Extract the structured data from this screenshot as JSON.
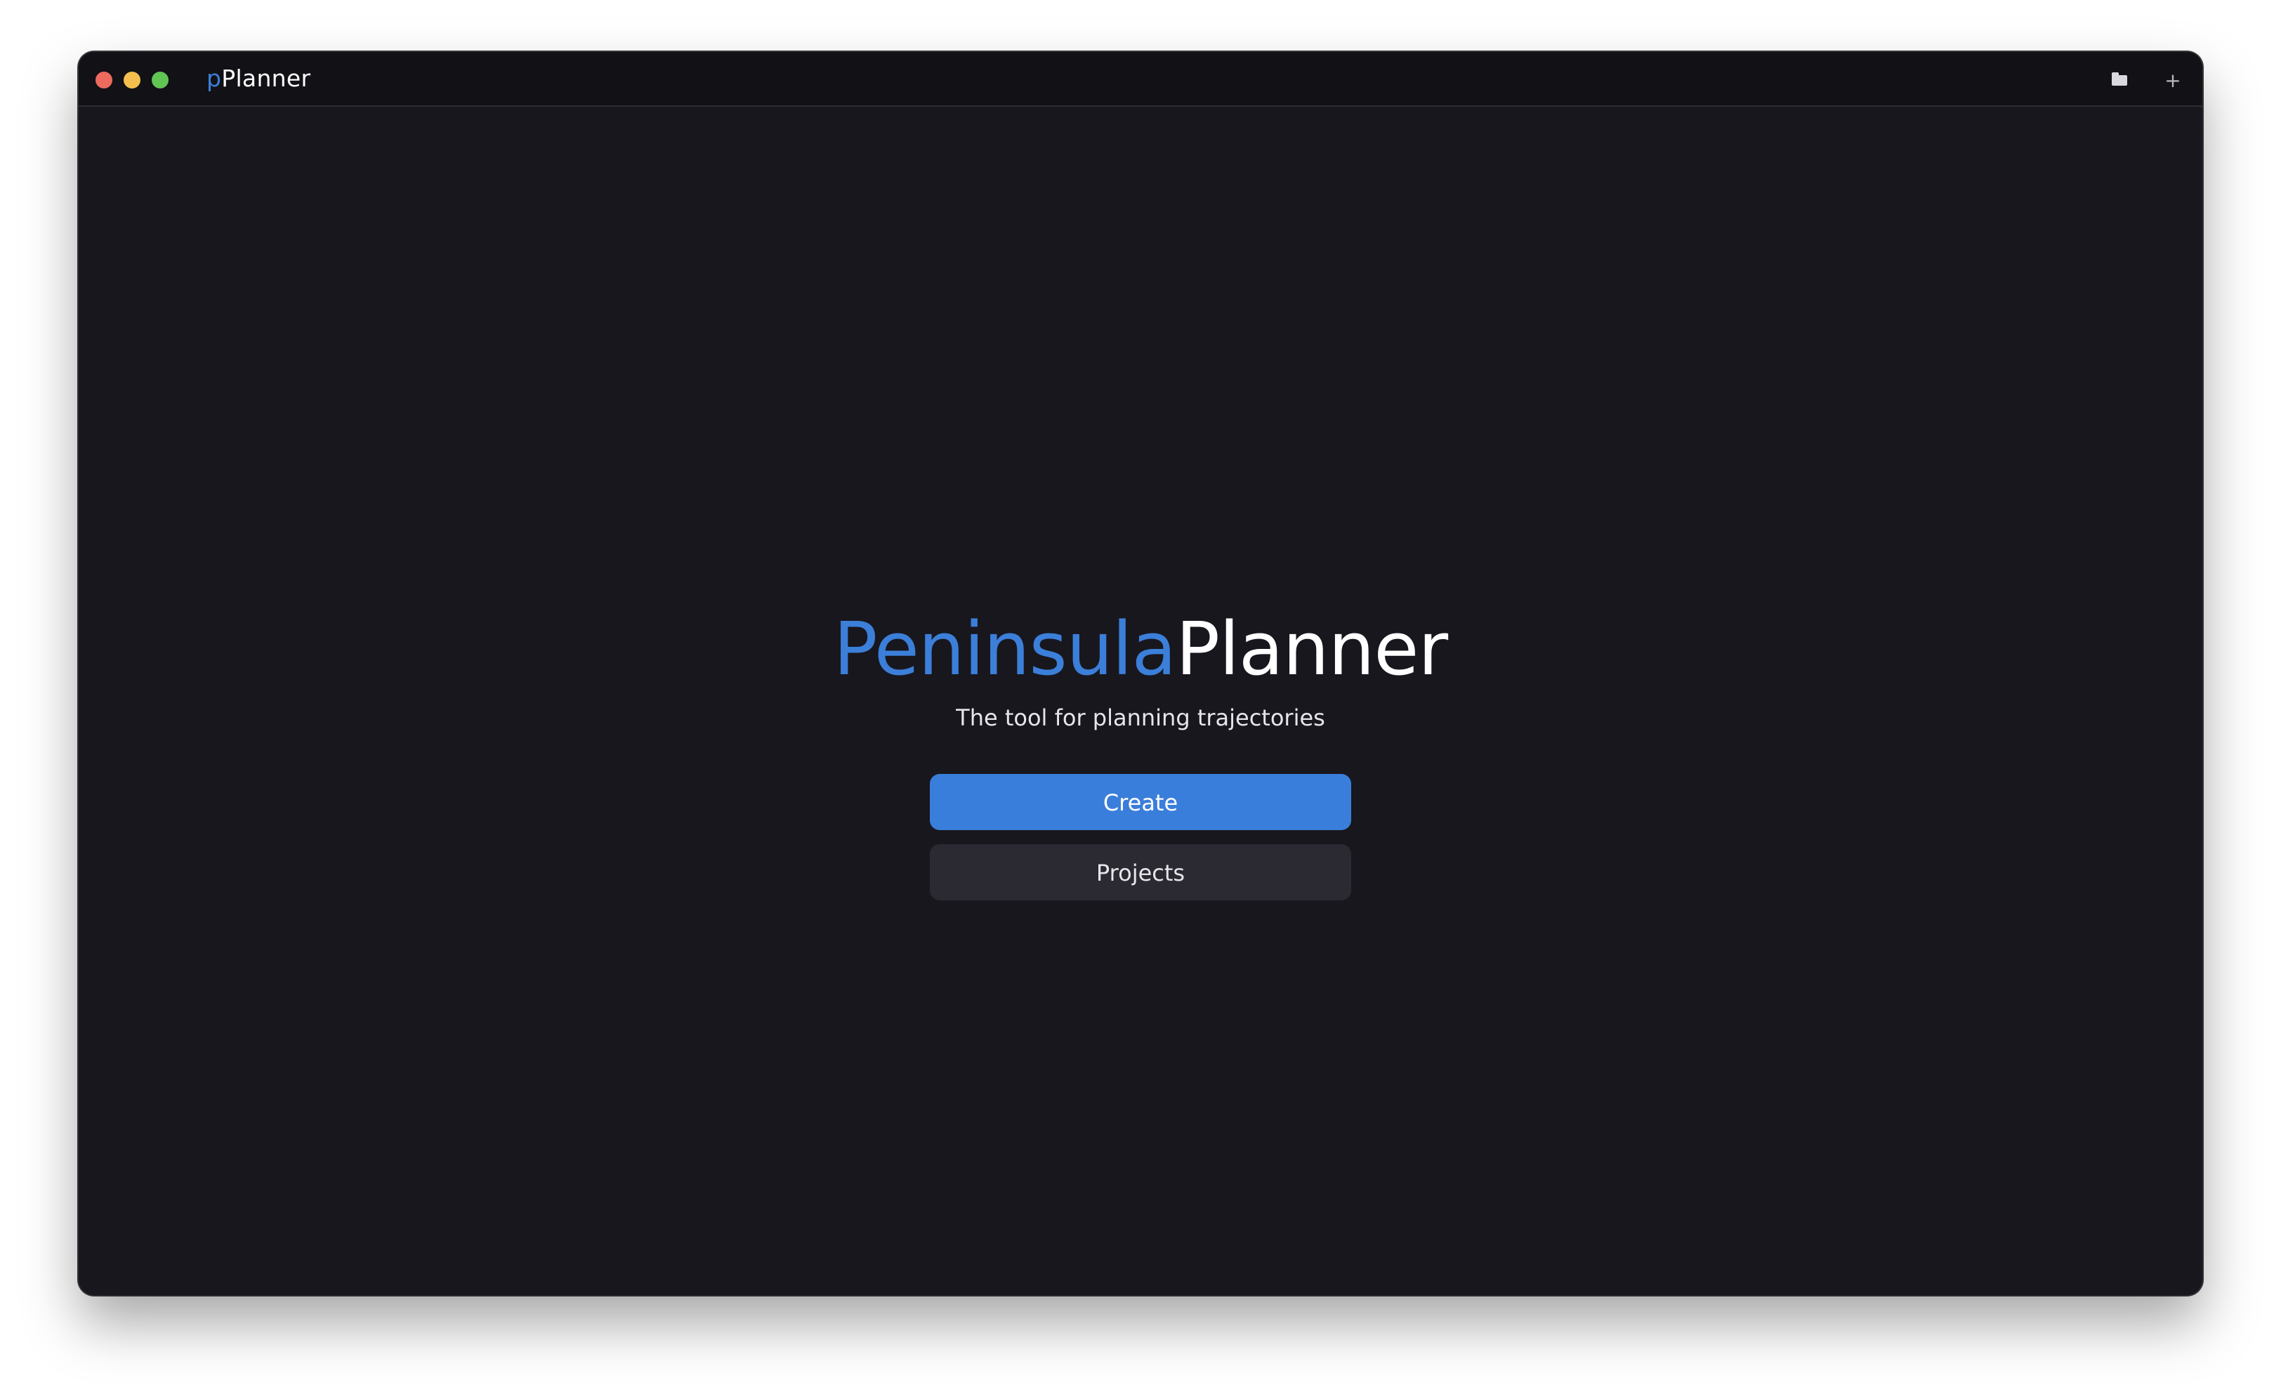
{
  "window": {
    "title_prefix": "p",
    "title_suffix": "Planner"
  },
  "toolbar": {
    "icons": [
      "folder-icon",
      "plus-icon"
    ],
    "plus_glyph": "+"
  },
  "hero": {
    "brand_part1": "Peninsula",
    "brand_part2": "Planner",
    "tagline": "The tool for planning trajectories"
  },
  "actions": {
    "create_label": "Create",
    "projects_label": "Projects"
  },
  "colors": {
    "accent": "#3b7fd9",
    "background": "#18171e",
    "titlebar": "#111116",
    "secondary_button": "#2b2a33"
  }
}
